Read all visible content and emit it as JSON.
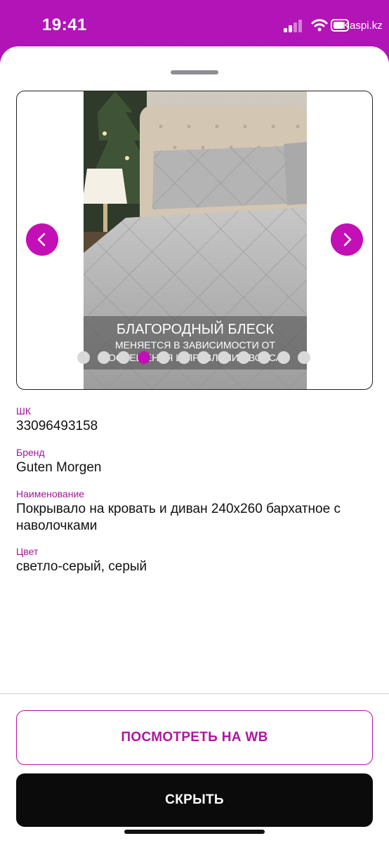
{
  "status_bar": {
    "time": "19:41",
    "carrier": "Kaspi.kz",
    "icons": [
      "signal-icon",
      "wifi-icon",
      "battery-icon"
    ]
  },
  "carousel": {
    "image_text": {
      "headline": "БЛАГОРОДНЫЙ БЛЕСК",
      "subline": "МЕНЯЕТСЯ В ЗАВИСИМОСТИ ОТ ОСВЕЩЕНИЯ И ПРАВЛЕНИЯ ВОРСА"
    },
    "total_slides": 12,
    "active_slide": 4,
    "prev_icon": "chevron-left-icon",
    "next_icon": "chevron-right-icon"
  },
  "details": {
    "barcode": {
      "label": "ШК",
      "value": "33096493158"
    },
    "brand": {
      "label": "Бренд",
      "value": "Guten Morgen"
    },
    "name": {
      "label": "Наименование",
      "value": "Покрывало на кровать и диван 240х260 бархатное с наволочками"
    },
    "color": {
      "label": "Цвет",
      "value": "светло-серый, серый"
    }
  },
  "actions": {
    "view_on_wb": "ПОСМОТРЕТЬ НА WB",
    "hide": "СКРЫТЬ"
  },
  "colors": {
    "accent": "#c30fb5",
    "header_gradient_top": "#b314b8",
    "dark_button": "#0b0b0b"
  }
}
